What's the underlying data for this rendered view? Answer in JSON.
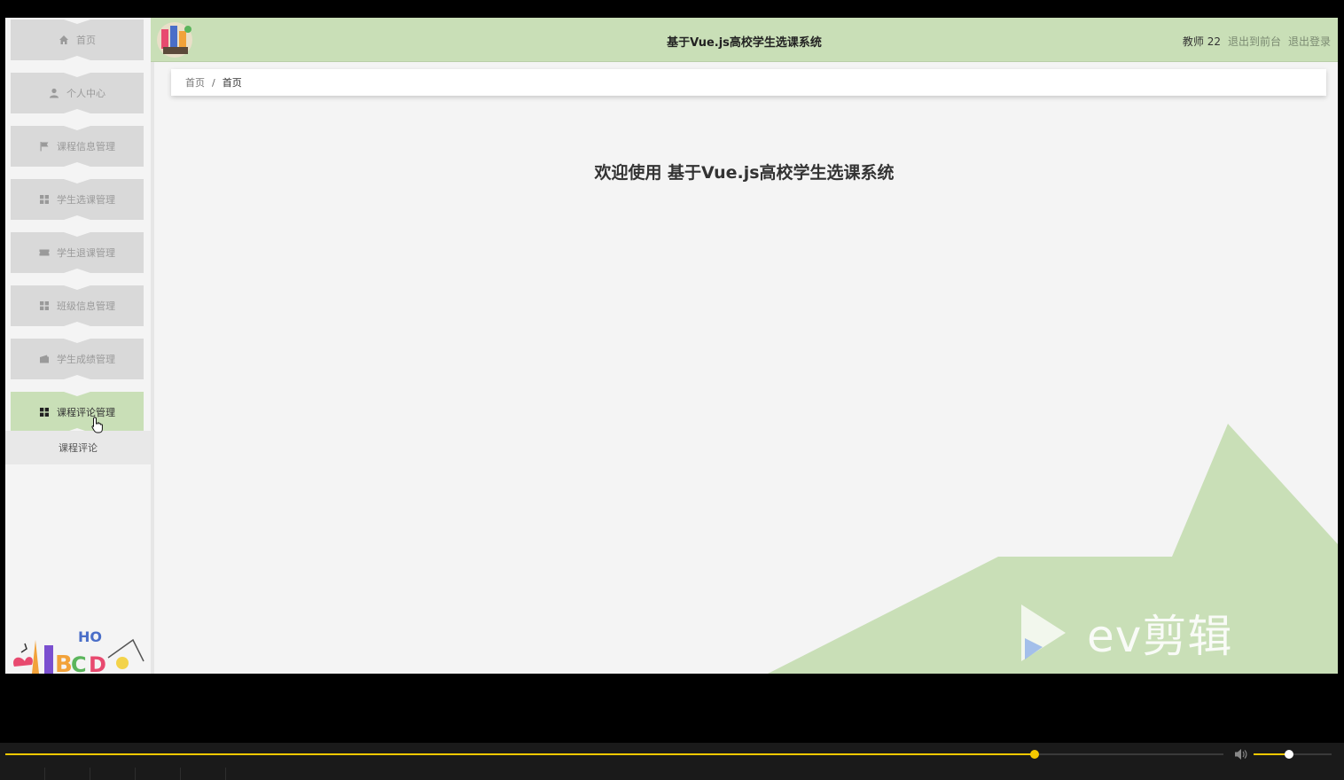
{
  "header": {
    "title": "基于Vue.js高校学生选课系统",
    "user": "教师 22",
    "to_front": "退出到前台",
    "logout": "退出登录"
  },
  "sidebar": {
    "items": [
      {
        "label": "首页",
        "icon": "home-icon"
      },
      {
        "label": "个人中心",
        "icon": "user-icon"
      },
      {
        "label": "课程信息管理",
        "icon": "flag-icon"
      },
      {
        "label": "学生选课管理",
        "icon": "grid-icon"
      },
      {
        "label": "学生退课管理",
        "icon": "ticket-icon"
      },
      {
        "label": "班级信息管理",
        "icon": "grid-icon"
      },
      {
        "label": "学生成绩管理",
        "icon": "wallet-icon"
      },
      {
        "label": "课程评论管理",
        "icon": "grid-icon",
        "active": true
      }
    ],
    "submenu": [
      "课程评论"
    ]
  },
  "breadcrumb": {
    "home": "首页",
    "separator": "/",
    "current": "首页"
  },
  "main": {
    "welcome": "欢迎使用 基于Vue.js高校学生选课系统"
  },
  "watermark": {
    "text": "ev剪辑"
  },
  "player": {
    "progress": 0.845,
    "volume": 0.45
  },
  "colors": {
    "accent_green": "#c9dfb7",
    "menu_gray": "#d9d9d9",
    "player_accent": "#f4c800"
  }
}
